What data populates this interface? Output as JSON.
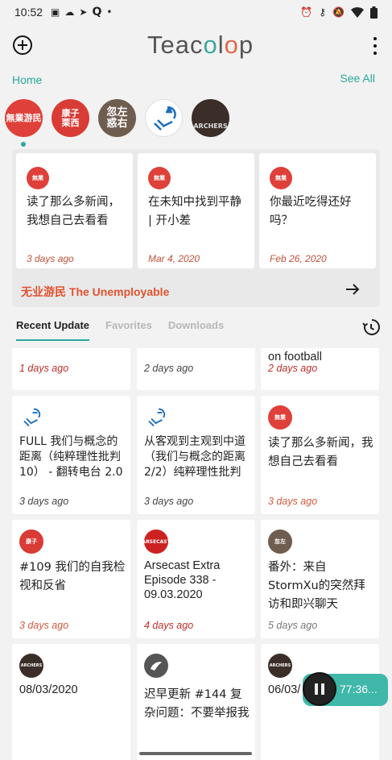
{
  "status_bar": {
    "time": "10:52",
    "icons_left": [
      "hindi-news-icon",
      "cloud-sun-icon",
      "telegram-icon",
      "q-icon",
      "dot-icon"
    ],
    "icons_right": [
      "alarm-icon",
      "key-icon",
      "mute-icon",
      "wifi-icon",
      "battery-icon"
    ]
  },
  "app_bar": {
    "logo": [
      "Tea",
      "c",
      "o",
      "l",
      "o",
      "p"
    ]
  },
  "home": {
    "label": "Home",
    "see_all": "See All"
  },
  "podcasts": [
    {
      "label": "無業游民",
      "color": "#e0403a"
    },
    {
      "label": "康子栗西",
      "color": "#d93b35"
    },
    {
      "label": "忽左 惑右",
      "color": "#6f5d4f"
    },
    {
      "label": "",
      "color": "#ffffff"
    },
    {
      "label": "ARCHERS",
      "color": "#3b2e28"
    }
  ],
  "featured": {
    "podcast_name": "无业游民 The Unemployable",
    "episodes": [
      {
        "title": "读了那么多新闻，我想自己去看看",
        "date": "3 days ago"
      },
      {
        "title": "在未知中找到平静 | 开小差",
        "date": "Mar 4, 2020"
      },
      {
        "title": "你最近吃得还好吗？",
        "date": "Feb 26, 2020"
      }
    ]
  },
  "tabs": [
    {
      "label": "Recent Update",
      "active": true
    },
    {
      "label": "Favorites",
      "active": false
    },
    {
      "label": "Downloads",
      "active": false
    }
  ],
  "grid": {
    "row0": [
      {
        "title": "",
        "date": "1 days ago"
      },
      {
        "title": "",
        "date": "2 days ago"
      },
      {
        "title": "on football",
        "date": "2 days ago"
      }
    ],
    "row1": [
      {
        "avatar": "doodle",
        "title": "FULL 我们与概念的距离（纯粹理性批判10） - 翻转电台 2.0",
        "date": "3 days ago"
      },
      {
        "avatar": "doodle",
        "title": "从客观到主观到中道（我们与概念的距离 2/2）纯粹理性批判",
        "date": "3 days ago"
      },
      {
        "avatar": "red",
        "title": "读了那么多新闻，我想自己去看看",
        "date": "3 days ago"
      }
    ],
    "row2": [
      {
        "avatar": "kangzi",
        "title": "#109 我们的自我检视和反省",
        "date": "3 days ago"
      },
      {
        "avatar": "arsecast",
        "title": "Arsecast Extra Episode 338 - 09.03.2020",
        "date": "4 days ago"
      },
      {
        "avatar": "brown",
        "title": "番外：来自StormXu的突然拜访和即兴聊天",
        "date": "5 days ago"
      }
    ],
    "row3": [
      {
        "avatar": "archers",
        "title": "08/03/2020",
        "date": ""
      },
      {
        "avatar": "bird",
        "title": "迟早更新 #144 复杂问题：不要举报我",
        "date": ""
      },
      {
        "avatar": "archers",
        "title": "06/03/",
        "date": ""
      }
    ]
  },
  "mini_player": {
    "time": "77:36..."
  }
}
